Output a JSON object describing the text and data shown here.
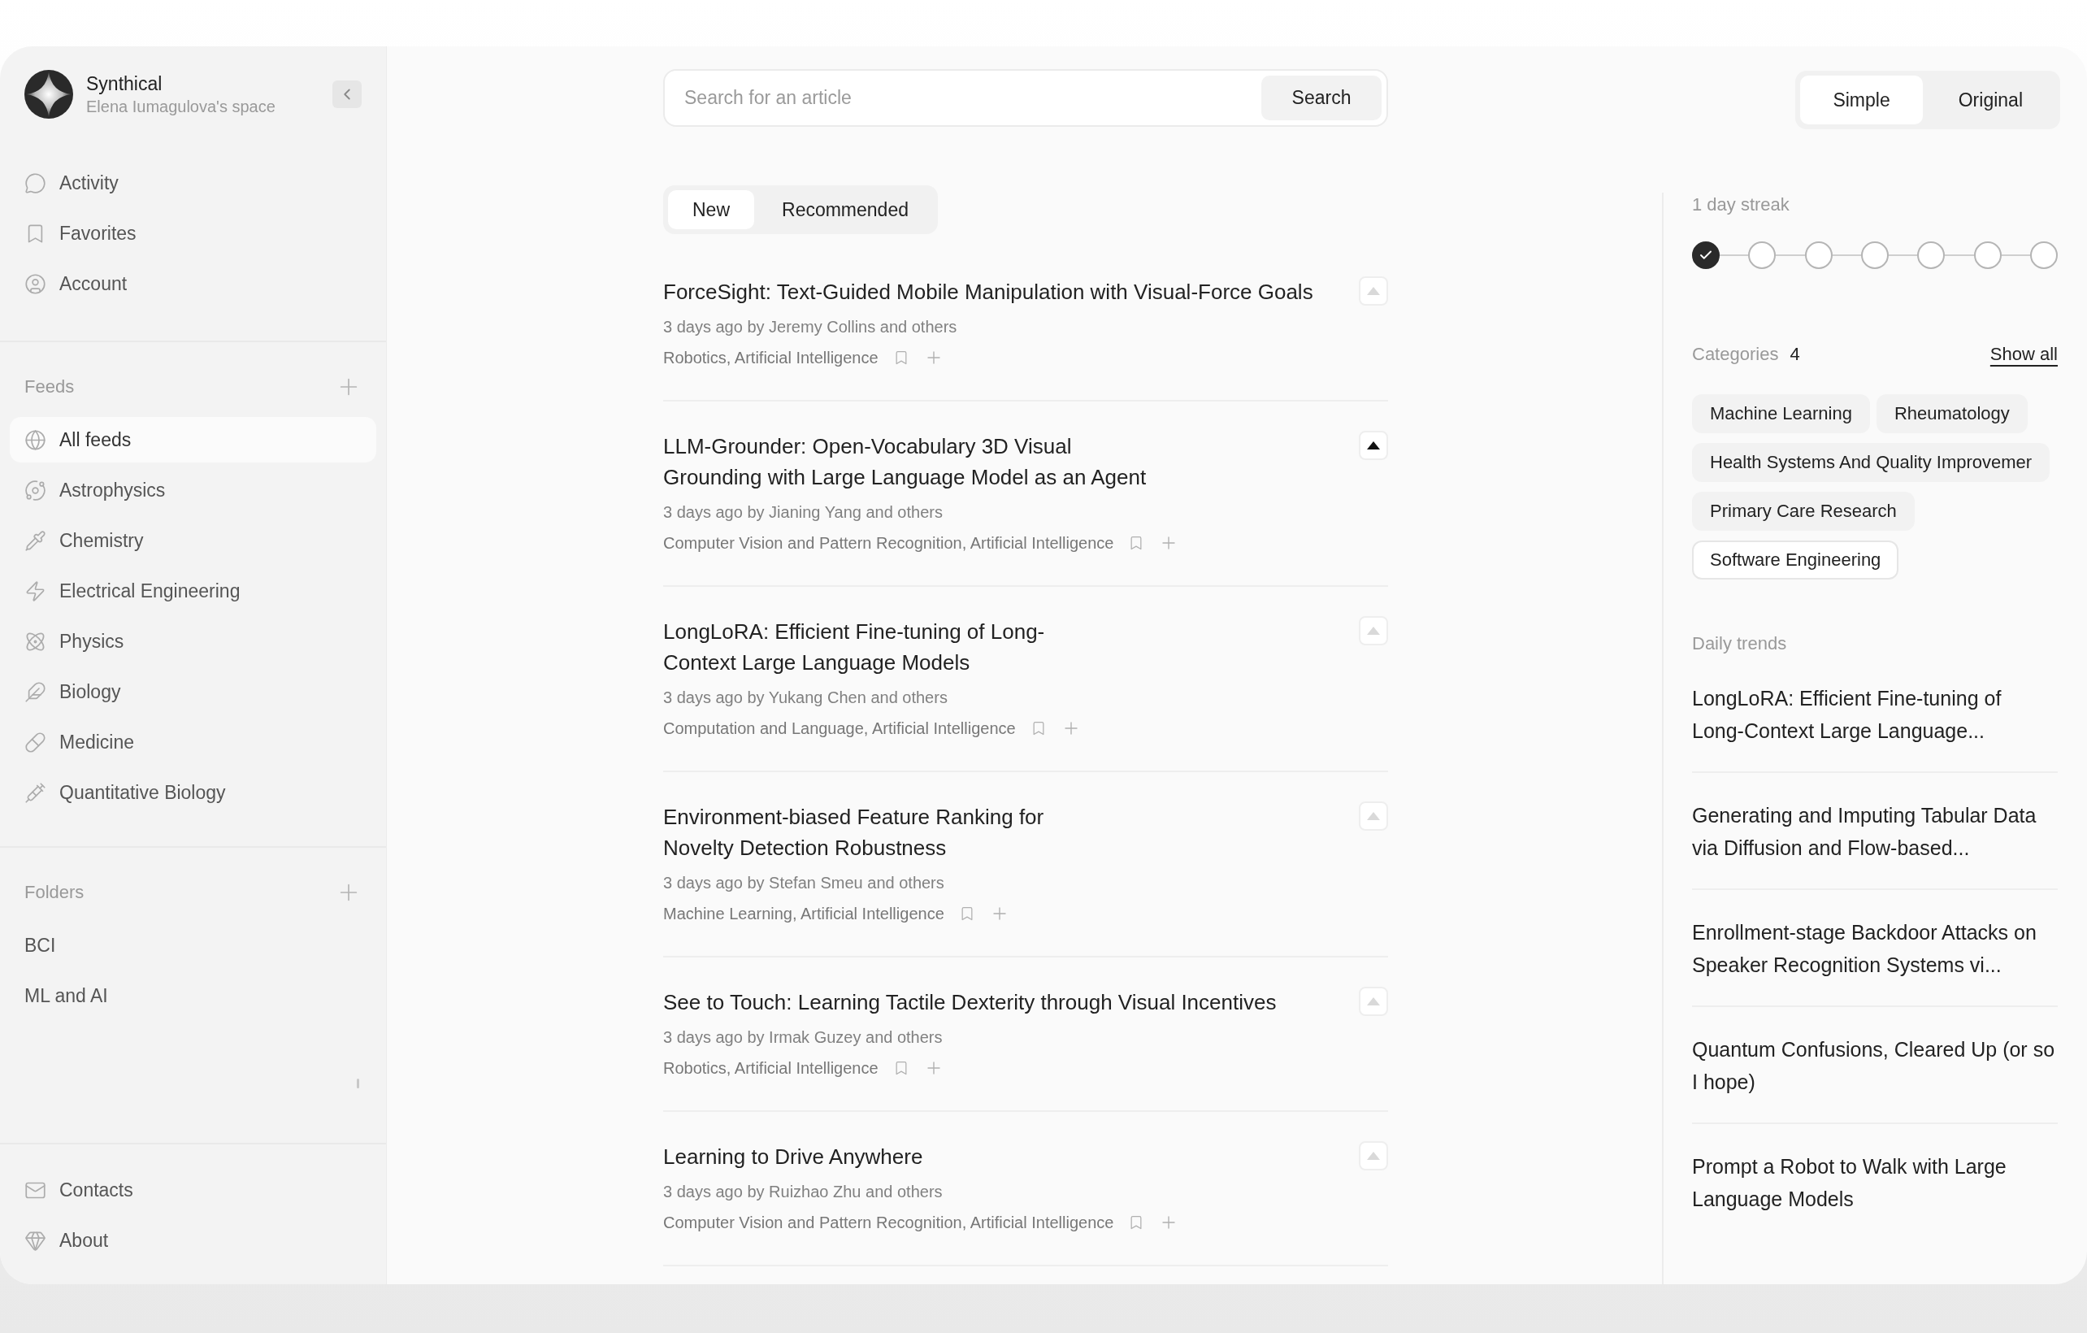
{
  "brand": {
    "name": "Synthical",
    "subtitle": "Elena Iumagulova's space"
  },
  "nav": [
    {
      "label": "Activity"
    },
    {
      "label": "Favorites"
    },
    {
      "label": "Account"
    }
  ],
  "feeds": {
    "title": "Feeds",
    "items": [
      {
        "label": "All feeds",
        "selected": true
      },
      {
        "label": "Astrophysics",
        "selected": false
      },
      {
        "label": "Chemistry",
        "selected": false
      },
      {
        "label": "Electrical Engineering",
        "selected": false
      },
      {
        "label": "Physics",
        "selected": false
      },
      {
        "label": "Biology",
        "selected": false
      },
      {
        "label": "Medicine",
        "selected": false
      },
      {
        "label": "Quantitative Biology",
        "selected": false
      }
    ]
  },
  "folders": {
    "title": "Folders",
    "items": [
      {
        "label": "BCI"
      },
      {
        "label": "ML and AI"
      }
    ]
  },
  "footer_nav": [
    {
      "label": "Contacts"
    },
    {
      "label": "About"
    }
  ],
  "search": {
    "placeholder": "Search for an article",
    "button": "Search"
  },
  "feed_tabs": [
    {
      "label": "New",
      "selected": true
    },
    {
      "label": "Recommended",
      "selected": false
    }
  ],
  "articles": [
    {
      "title": "ForceSight: Text-Guided Mobile Manipulation with Visual-Force Goals",
      "meta": "3 days ago by Jeremy Collins and others",
      "categories": "Robotics, Artificial Intelligence",
      "upvoted": false
    },
    {
      "title": "LLM-Grounder: Open-Vocabulary 3D Visual Grounding with Large Language Model as an Agent",
      "meta": "3 days ago by Jianing Yang and others",
      "categories": "Computer Vision and Pattern Recognition, Artificial Intelligence",
      "upvoted": true
    },
    {
      "title": "LongLoRA: Efficient Fine-tuning of Long-Context Large Language Models",
      "meta": "3 days ago by Yukang Chen and others",
      "categories": "Computation and Language, Artificial Intelligence",
      "upvoted": false
    },
    {
      "title": "Environment-biased Feature Ranking for Novelty Detection Robustness",
      "meta": "3 days ago by Stefan Smeu and others",
      "categories": "Machine Learning, Artificial Intelligence",
      "upvoted": false
    },
    {
      "title": "See to Touch: Learning Tactile Dexterity through Visual Incentives",
      "meta": "3 days ago by Irmak Guzey and others",
      "categories": "Robotics, Artificial Intelligence",
      "upvoted": false
    },
    {
      "title": "Learning to Drive Anywhere",
      "meta": "3 days ago by Ruizhao Zhu and others",
      "categories": "Computer Vision and Pattern Recognition, Artificial Intelligence",
      "upvoted": false
    }
  ],
  "view_toggle": [
    {
      "label": "Simple",
      "selected": true
    },
    {
      "label": "Original",
      "selected": false
    }
  ],
  "streak": {
    "label": "1 day streak",
    "days": [
      {
        "done": true
      },
      {
        "done": false
      },
      {
        "done": false
      },
      {
        "done": false
      },
      {
        "done": false
      },
      {
        "done": false
      },
      {
        "done": false
      }
    ]
  },
  "categories": {
    "title": "Categories",
    "count": "4",
    "show_all": "Show all",
    "tags": [
      {
        "label": "Machine Learning",
        "selected": false
      },
      {
        "label": "Rheumatology",
        "selected": false
      },
      {
        "label": "Health Systems And Quality Improvemer",
        "selected": false
      },
      {
        "label": "Primary Care Research",
        "selected": false
      },
      {
        "label": "Software Engineering",
        "selected": true
      }
    ]
  },
  "trends": {
    "title": "Daily trends",
    "items": [
      "LongLoRA: Efficient Fine-tuning of Long-Context Large Language...",
      "Generating and Imputing Tabular Data via Diffusion and Flow-based...",
      "Enrollment-stage Backdoor Attacks on Speaker Recognition Systems vi...",
      "Quantum Confusions, Cleared Up (or so I hope)",
      "Prompt a Robot to Walk with Large Language Models"
    ]
  }
}
